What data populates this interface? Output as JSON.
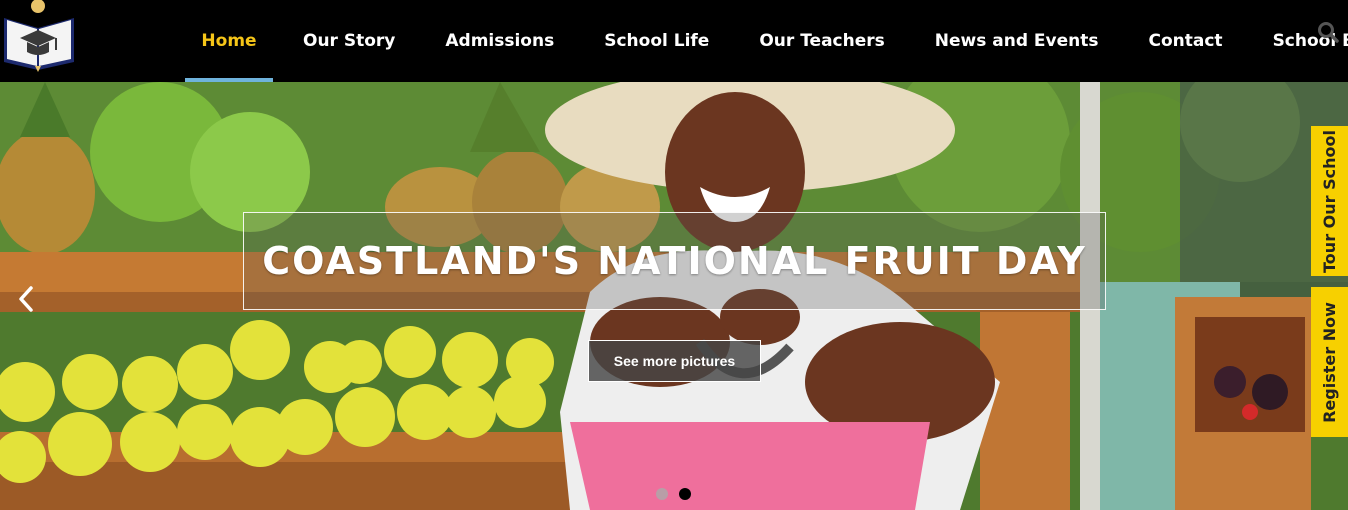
{
  "header": {
    "logo_icon": "school-book-logo-icon",
    "nav": [
      {
        "label": "Home",
        "active": true
      },
      {
        "label": "Our Story",
        "active": false
      },
      {
        "label": "Admissions",
        "active": false
      },
      {
        "label": "School Life",
        "active": false
      },
      {
        "label": "Our Teachers",
        "active": false
      },
      {
        "label": "News and Events",
        "active": false
      },
      {
        "label": "Contact",
        "active": false
      },
      {
        "label": "School Blog",
        "active": false
      }
    ],
    "search_icon": "search-icon"
  },
  "hero": {
    "title": "COASTLAND'S NATIONAL FRUIT DAY",
    "button_label": "See more pictures",
    "prev_icon": "chevron-left-icon",
    "slides": {
      "total": 2,
      "active": 2
    }
  },
  "side_tabs": {
    "tour": "Tour Our School",
    "register": "Register Now"
  },
  "colors": {
    "active_nav": "#f5c518",
    "nav_underline": "#6fb3dc",
    "side_tab": "#f7d000"
  }
}
